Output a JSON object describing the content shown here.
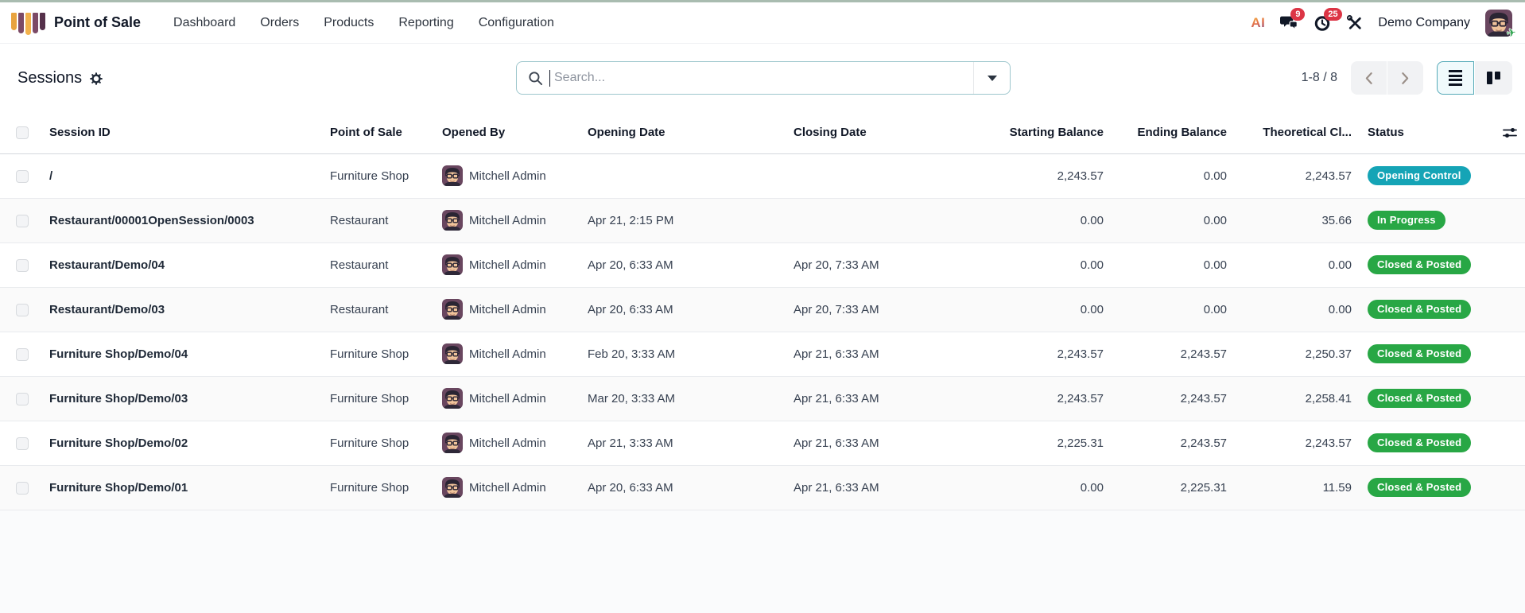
{
  "topbar": {
    "brand": "Point of Sale",
    "menu": [
      "Dashboard",
      "Orders",
      "Products",
      "Reporting",
      "Configuration"
    ],
    "ai_label": "AI",
    "messages_badge": "9",
    "activities_badge": "25",
    "company": "Demo Company"
  },
  "control_panel": {
    "title": "Sessions",
    "search": {
      "placeholder": "Search...",
      "value": ""
    },
    "pager": {
      "text": "1-8 / 8"
    }
  },
  "table": {
    "columns": {
      "session_id": "Session ID",
      "point_of_sale": "Point of Sale",
      "opened_by": "Opened By",
      "opening_date": "Opening Date",
      "closing_date": "Closing Date",
      "starting_balance": "Starting Balance",
      "ending_balance": "Ending Balance",
      "theoretical_closing": "Theoretical Cl...",
      "status": "Status"
    },
    "rows": [
      {
        "session_id": "/",
        "point_of_sale": "Furniture Shop",
        "opened_by": "Mitchell Admin",
        "opening_date": "",
        "closing_date": "",
        "starting_balance": "2,243.57",
        "ending_balance": "0.00",
        "theoretical_closing": "2,243.57",
        "status": "Opening Control",
        "status_class": "badge badge-teal"
      },
      {
        "session_id": "Restaurant/00001OpenSession/0003",
        "point_of_sale": "Restaurant",
        "opened_by": "Mitchell Admin",
        "opening_date": "Apr 21, 2:15 PM",
        "closing_date": "",
        "starting_balance": "0.00",
        "ending_balance": "0.00",
        "theoretical_closing": "35.66",
        "status": "In Progress",
        "status_class": "badge badge-green"
      },
      {
        "session_id": "Restaurant/Demo/04",
        "point_of_sale": "Restaurant",
        "opened_by": "Mitchell Admin",
        "opening_date": "Apr 20, 6:33 AM",
        "closing_date": "Apr 20, 7:33 AM",
        "starting_balance": "0.00",
        "ending_balance": "0.00",
        "theoretical_closing": "0.00",
        "status": "Closed & Posted",
        "status_class": "badge badge-green"
      },
      {
        "session_id": "Restaurant/Demo/03",
        "point_of_sale": "Restaurant",
        "opened_by": "Mitchell Admin",
        "opening_date": "Apr 20, 6:33 AM",
        "closing_date": "Apr 20, 7:33 AM",
        "starting_balance": "0.00",
        "ending_balance": "0.00",
        "theoretical_closing": "0.00",
        "status": "Closed & Posted",
        "status_class": "badge badge-green"
      },
      {
        "session_id": "Furniture Shop/Demo/04",
        "point_of_sale": "Furniture Shop",
        "opened_by": "Mitchell Admin",
        "opening_date": "Feb 20, 3:33 AM",
        "closing_date": "Apr 21, 6:33 AM",
        "starting_balance": "2,243.57",
        "ending_balance": "2,243.57",
        "theoretical_closing": "2,250.37",
        "status": "Closed & Posted",
        "status_class": "badge badge-green"
      },
      {
        "session_id": "Furniture Shop/Demo/03",
        "point_of_sale": "Furniture Shop",
        "opened_by": "Mitchell Admin",
        "opening_date": "Mar 20, 3:33 AM",
        "closing_date": "Apr 21, 6:33 AM",
        "starting_balance": "2,243.57",
        "ending_balance": "2,243.57",
        "theoretical_closing": "2,258.41",
        "status": "Closed & Posted",
        "status_class": "badge badge-green"
      },
      {
        "session_id": "Furniture Shop/Demo/02",
        "point_of_sale": "Furniture Shop",
        "opened_by": "Mitchell Admin",
        "opening_date": "Apr 21, 3:33 AM",
        "closing_date": "Apr 21, 6:33 AM",
        "starting_balance": "2,225.31",
        "ending_balance": "2,243.57",
        "theoretical_closing": "2,243.57",
        "status": "Closed & Posted",
        "status_class": "badge badge-green"
      },
      {
        "session_id": "Furniture Shop/Demo/01",
        "point_of_sale": "Furniture Shop",
        "opened_by": "Mitchell Admin",
        "opening_date": "Apr 20, 6:33 AM",
        "closing_date": "Apr 21, 6:33 AM",
        "starting_balance": "0.00",
        "ending_balance": "2,225.31",
        "theoretical_closing": "11.59",
        "status": "Closed & Posted",
        "status_class": "badge badge-green"
      }
    ]
  },
  "icons": {
    "pos_logo": "striped-awning",
    "search": "magnifier",
    "search_dropdown": "caret-down",
    "title_gear": "cog",
    "pager_prev": "chevron-left",
    "pager_next": "chevron-right",
    "view_list": "list-lines",
    "view_kanban": "kanban-columns",
    "messages": "chat-bubbles",
    "activities": "clock",
    "tools": "wrench-screwdriver",
    "out_of_office": "plane",
    "optional_columns": "adjust-sliders"
  },
  "colors": {
    "top_accent": "#a9bcb0",
    "brand_purple": "#7c4a66",
    "brand_orange": "#f2b14b",
    "badge_teal": "#15a4b6",
    "badge_green": "#28a745",
    "notification_red": "#dc3545",
    "search_border": "#9ec7cd",
    "active_view_border": "#55aab8"
  }
}
